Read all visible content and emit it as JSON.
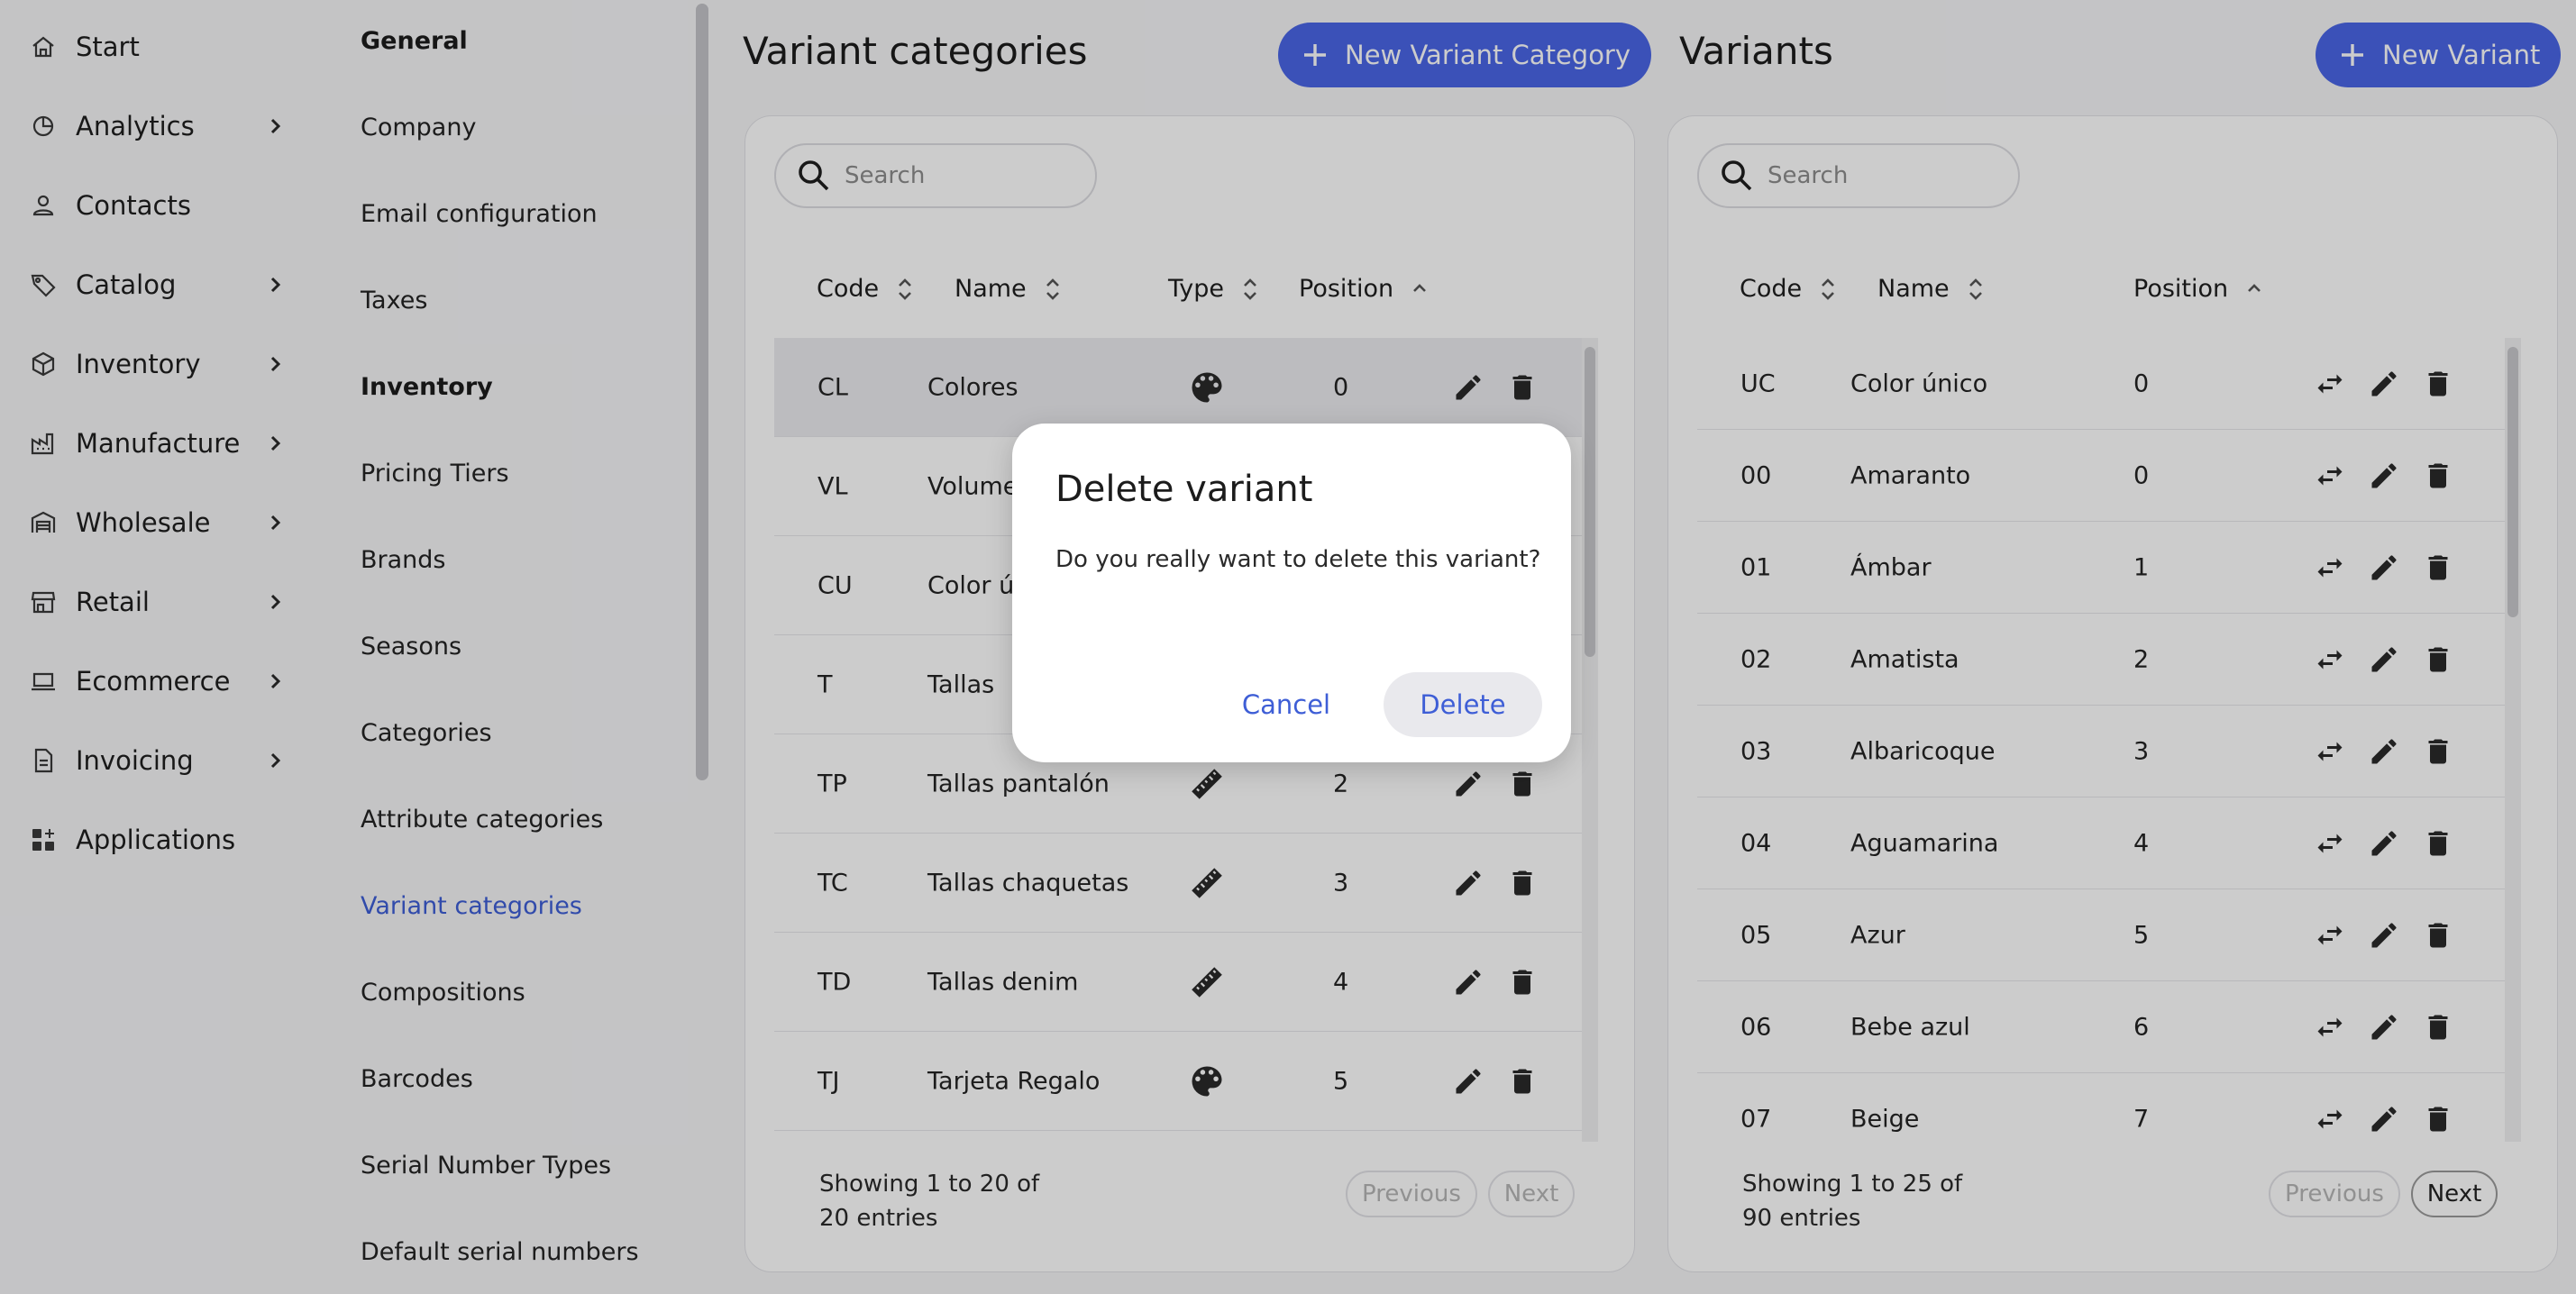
{
  "nav": {
    "items": [
      {
        "label": "Start",
        "icon": "home-icon",
        "chevron": false
      },
      {
        "label": "Analytics",
        "icon": "analytics-icon",
        "chevron": true
      },
      {
        "label": "Contacts",
        "icon": "person-icon",
        "chevron": false
      },
      {
        "label": "Catalog",
        "icon": "tag-icon",
        "chevron": true
      },
      {
        "label": "Inventory",
        "icon": "box-icon",
        "chevron": true
      },
      {
        "label": "Manufacture",
        "icon": "factory-icon",
        "chevron": true
      },
      {
        "label": "Wholesale",
        "icon": "warehouse-icon",
        "chevron": true
      },
      {
        "label": "Retail",
        "icon": "store-icon",
        "chevron": true
      },
      {
        "label": "Ecommerce",
        "icon": "laptop-icon",
        "chevron": true
      },
      {
        "label": "Invoicing",
        "icon": "document-icon",
        "chevron": true
      },
      {
        "label": "Applications",
        "icon": "apps-icon",
        "chevron": false
      }
    ]
  },
  "settings_menu": {
    "items": [
      {
        "label": "General",
        "type": "head"
      },
      {
        "label": "Company",
        "type": "link"
      },
      {
        "label": "Email configuration",
        "type": "link"
      },
      {
        "label": "Taxes",
        "type": "link"
      },
      {
        "label": "Inventory",
        "type": "head"
      },
      {
        "label": "Pricing Tiers",
        "type": "link"
      },
      {
        "label": "Brands",
        "type": "link"
      },
      {
        "label": "Seasons",
        "type": "link"
      },
      {
        "label": "Categories",
        "type": "link"
      },
      {
        "label": "Attribute categories",
        "type": "link"
      },
      {
        "label": "Variant categories",
        "type": "active"
      },
      {
        "label": "Compositions",
        "type": "link"
      },
      {
        "label": "Barcodes",
        "type": "link"
      },
      {
        "label": "Serial Number Types",
        "type": "link"
      },
      {
        "label": "Default serial numbers",
        "type": "link"
      }
    ]
  },
  "variant_categories": {
    "title": "Variant categories",
    "new_button": "New Variant Category",
    "search_placeholder": "Search",
    "columns": {
      "code": "Code",
      "name": "Name",
      "type": "Type",
      "position": "Position"
    },
    "rows": [
      {
        "code": "CL",
        "name": "Colores",
        "type": "palette-icon",
        "position": "0"
      },
      {
        "code": "VL",
        "name": "Volume",
        "type": "",
        "position": ""
      },
      {
        "code": "CU",
        "name": "Color ú",
        "type": "",
        "position": ""
      },
      {
        "code": "T",
        "name": "Tallas",
        "type": "",
        "position": ""
      },
      {
        "code": "TP",
        "name": "Tallas pantalón",
        "type": "ruler-icon",
        "position": "2"
      },
      {
        "code": "TC",
        "name": "Tallas chaquetas",
        "type": "ruler-icon",
        "position": "3"
      },
      {
        "code": "TD",
        "name": "Tallas denim",
        "type": "ruler-icon",
        "position": "4"
      },
      {
        "code": "TJ",
        "name": "Tarjeta Regalo",
        "type": "palette-icon",
        "position": "5"
      }
    ],
    "footer": "Showing 1 to 20 of 20 entries",
    "footer_line1": "Showing 1 to 20 of",
    "footer_line2": "20 entries",
    "prev": "Previous",
    "next": "Next"
  },
  "variants": {
    "title": "Variants",
    "new_button": "New Variant",
    "search_placeholder": "Search",
    "columns": {
      "code": "Code",
      "name": "Name",
      "position": "Position"
    },
    "rows": [
      {
        "code": "UC",
        "name": "Color único",
        "position": "0"
      },
      {
        "code": "00",
        "name": "Amaranto",
        "position": "0"
      },
      {
        "code": "01",
        "name": "Ámbar",
        "position": "1"
      },
      {
        "code": "02",
        "name": "Amatista",
        "position": "2"
      },
      {
        "code": "03",
        "name": "Albaricoque",
        "position": "3"
      },
      {
        "code": "04",
        "name": "Aguamarina",
        "position": "4"
      },
      {
        "code": "05",
        "name": "Azur",
        "position": "5"
      },
      {
        "code": "06",
        "name": "Bebe azul",
        "position": "6"
      },
      {
        "code": "07",
        "name": "Beige",
        "position": "7"
      }
    ],
    "footer_line1": "Showing 1 to 25 of",
    "footer_line2": "90 entries",
    "prev": "Previous",
    "next": "Next"
  },
  "modal": {
    "title": "Delete variant",
    "body": "Do you really want to delete this variant?",
    "cancel": "Cancel",
    "delete": "Delete"
  },
  "colors": {
    "accent": "#4a66e6",
    "active_link": "#3e5ed6",
    "overlay": "rgba(0,0,0,0.20)"
  }
}
